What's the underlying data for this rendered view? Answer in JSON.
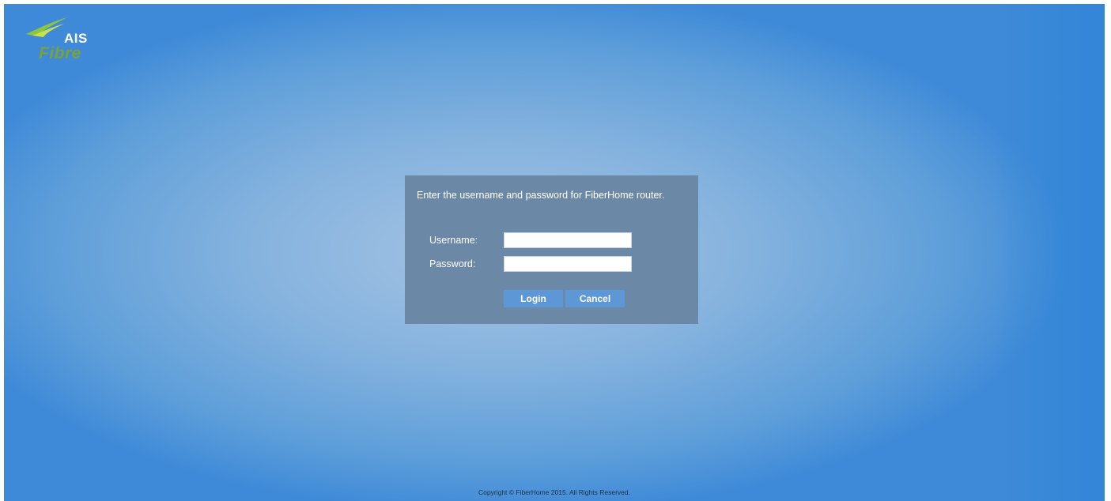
{
  "brand": {
    "ais": "AIS",
    "fibre": "Fibre",
    "colors": {
      "swoosh": "#8cc63f",
      "fibre": "#7aa23b"
    }
  },
  "login": {
    "prompt": "Enter the username and password for FiberHome router.",
    "username_label": "Username:",
    "password_label": "Password:",
    "username_value": "",
    "password_value": "",
    "login_button": "Login",
    "cancel_button": "Cancel"
  },
  "footer": {
    "copyright": "Copyright © FiberHome 2015. All Rights Reserved."
  }
}
